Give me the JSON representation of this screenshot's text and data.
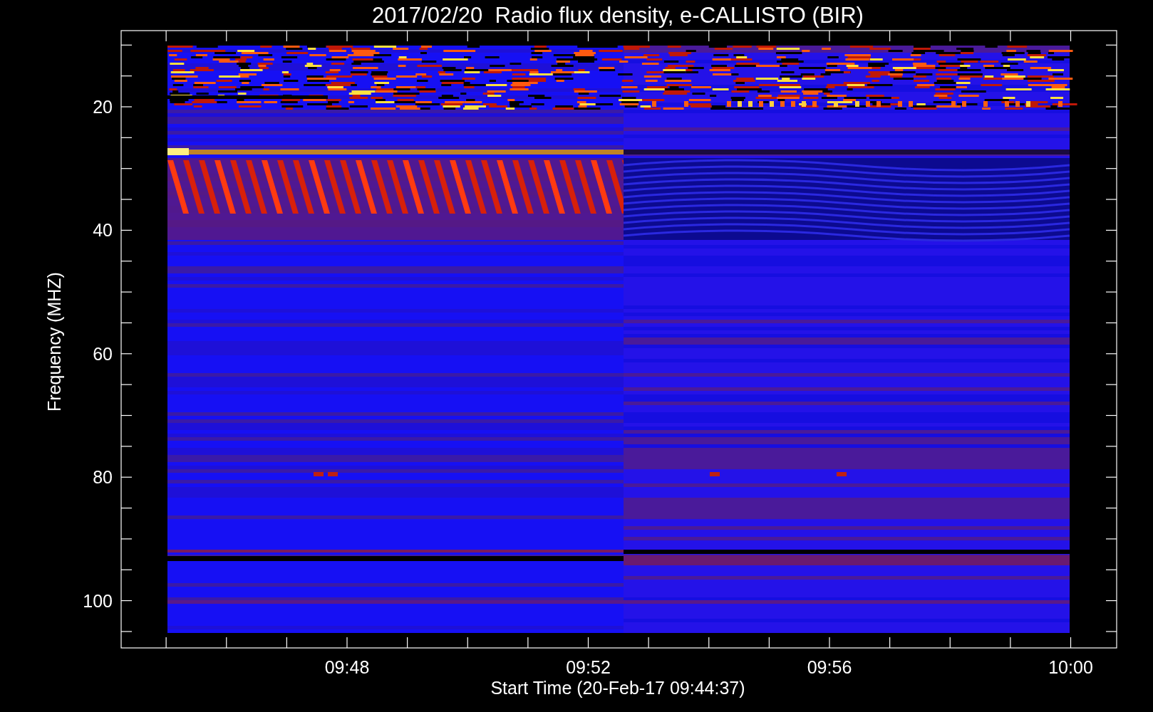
{
  "title": "2017/02/20  Radio flux density, e-CALLISTO (BIR)",
  "y_axis": {
    "label": "Frequency (MHZ)",
    "ticks": [
      "20",
      "40",
      "60",
      "80",
      "100"
    ]
  },
  "x_axis": {
    "label": "Start Time (20-Feb-17 09:44:37)",
    "ticks": [
      "09:48",
      "09:52",
      "09:56",
      "10:00"
    ]
  }
}
